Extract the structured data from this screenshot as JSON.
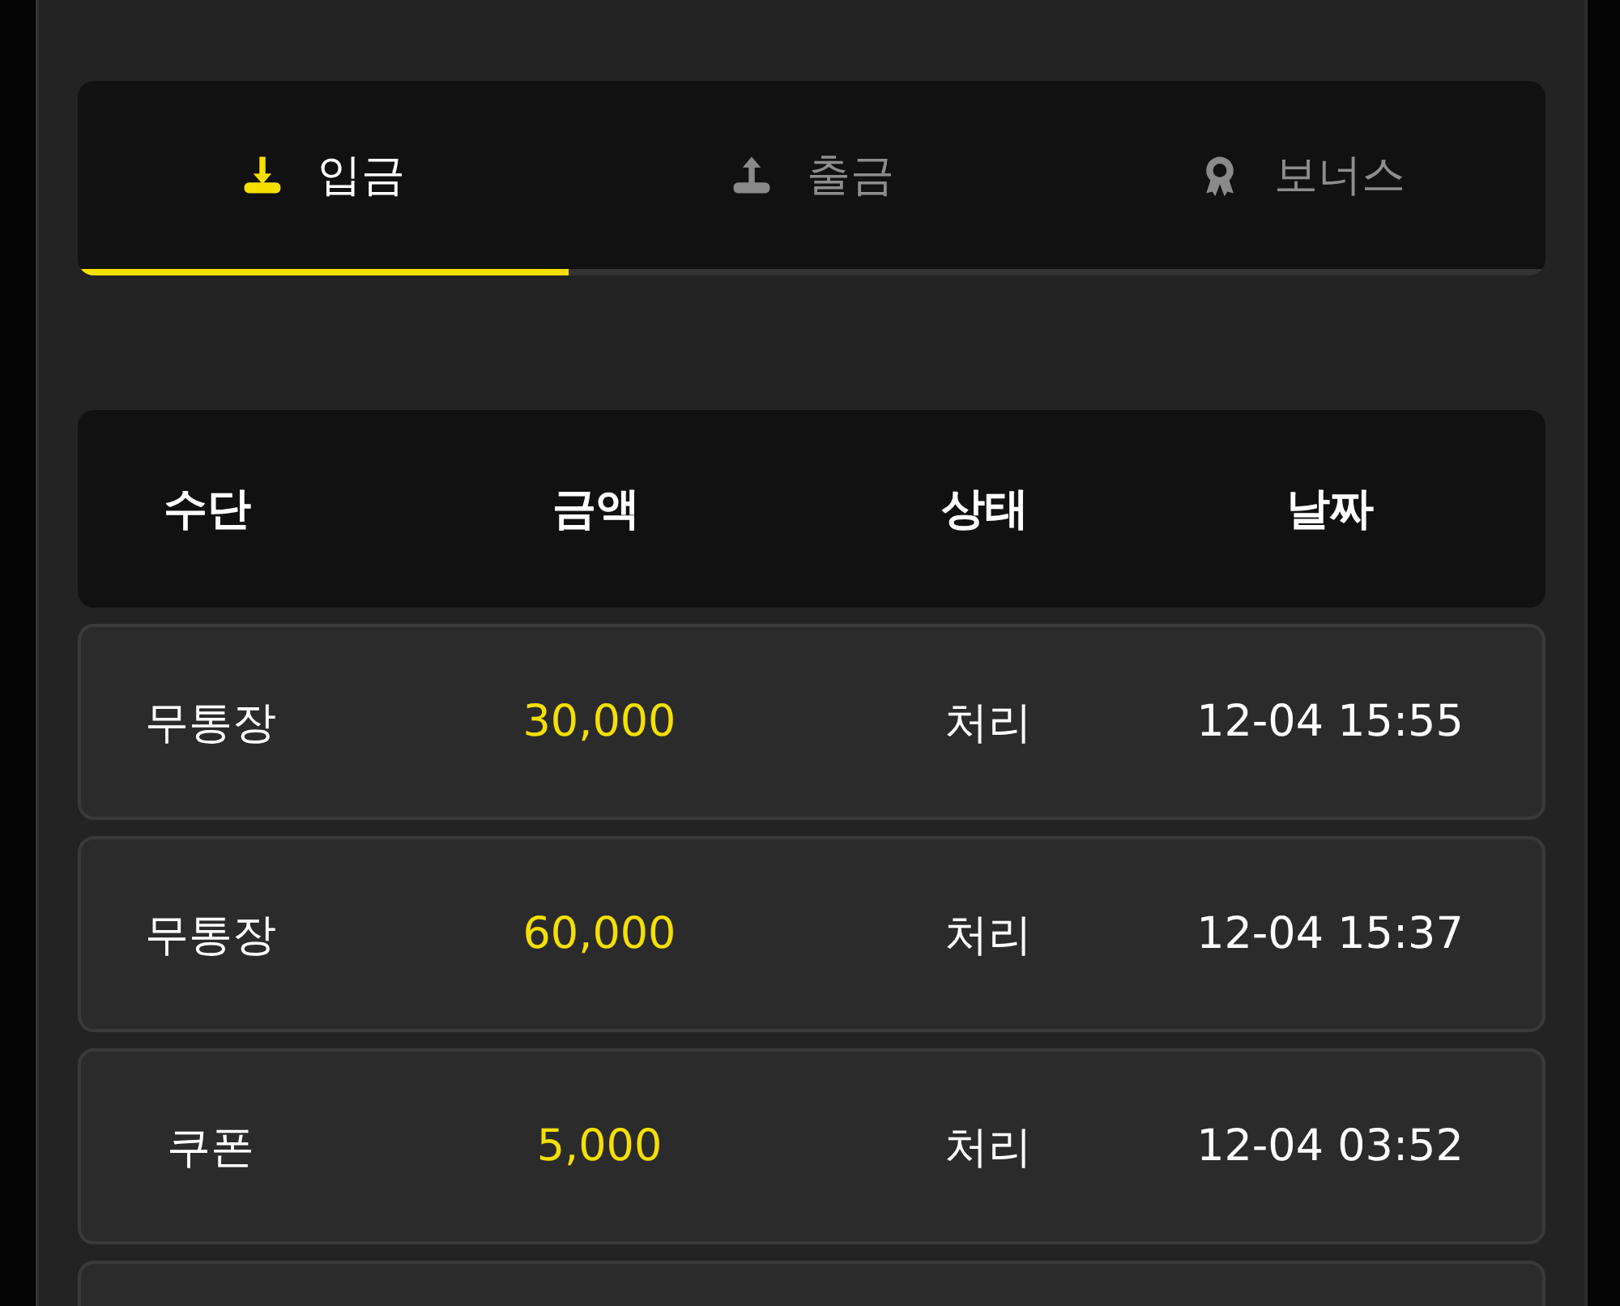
{
  "tabs": [
    {
      "label": "입금",
      "kind": "deposit",
      "selected": true
    },
    {
      "label": "출금",
      "kind": "withdraw",
      "selected": false
    },
    {
      "label": "보너스",
      "kind": "bonus",
      "selected": false
    }
  ],
  "table": {
    "columns": [
      "수단",
      "금액",
      "상태",
      "날짜"
    ],
    "rows": [
      {
        "kind": "entry",
        "method": "무통장",
        "amount": "30,000",
        "status": "처리",
        "date": "12-04 15:55"
      },
      {
        "kind": "entry",
        "method": "무통장",
        "amount": "60,000",
        "status": "처리",
        "date": "12-04 15:37"
      },
      {
        "kind": "entry",
        "method": "쿠폰",
        "amount": "5,000",
        "status": "처리",
        "date": "12-04 03:52"
      },
      {
        "kind": "cut"
      }
    ]
  }
}
